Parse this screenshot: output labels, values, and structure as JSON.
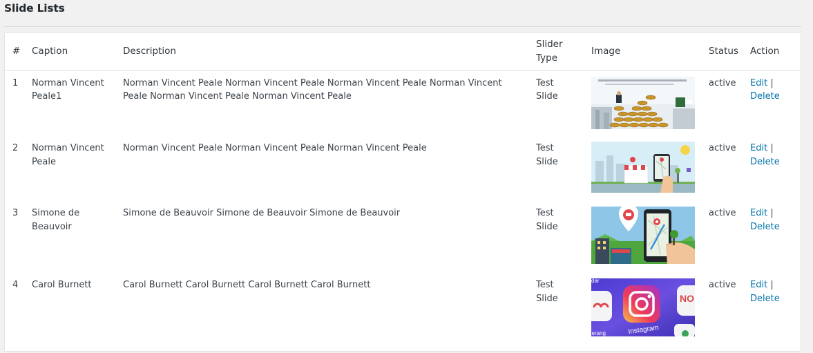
{
  "page": {
    "title": "Slide Lists"
  },
  "table": {
    "headers": {
      "num": "#",
      "caption": "Caption",
      "description": "Description",
      "slider_type_line1": "Slider",
      "slider_type_line2": "Type",
      "image": "Image",
      "status": "Status",
      "action": "Action"
    },
    "rows": [
      {
        "num": "1",
        "caption": "Norman Vincent Peale1",
        "description": "Norman Vincent Peale Norman Vincent Peale Norman Vincent Peale Norman Vincent Peale Norman Vincent Peale Norman Vincent Peale",
        "slider_type": "Test Slide",
        "image": "coins-businessman-thumbnail",
        "status": "active",
        "edit": "Edit",
        "separator": "|",
        "delete": "Delete"
      },
      {
        "num": "2",
        "caption": "Norman Vincent Peale",
        "description": "Norman Vincent Peale Norman Vincent Peale Norman Vincent Peale",
        "slider_type": "Test Slide",
        "image": "city-shop-phone-map-thumbnail",
        "status": "active",
        "edit": "Edit",
        "separator": "|",
        "delete": "Delete"
      },
      {
        "num": "3",
        "caption": "Simone de Beauvoir",
        "description": "Simone de Beauvoir Simone de Beauvoir Simone de Beauvoir",
        "slider_type": "Test Slide",
        "image": "map-pin-phone-navigation-thumbnail",
        "status": "active",
        "edit": "Edit",
        "separator": "|",
        "delete": "Delete"
      },
      {
        "num": "4",
        "caption": "Carol Burnett",
        "description": "Carol Burnett Carol Burnett Carol Burnett Carol Burnett",
        "slider_type": "Test Slide",
        "image": "instagram-app-icons-thumbnail",
        "image_text": "Instagram",
        "status": "active",
        "edit": "Edit",
        "separator": "|",
        "delete": "Delete"
      }
    ]
  },
  "colors": {
    "link": "#0073aa",
    "background": "#f1f1f1",
    "panel": "#ffffff",
    "border": "#e1e1e1"
  }
}
